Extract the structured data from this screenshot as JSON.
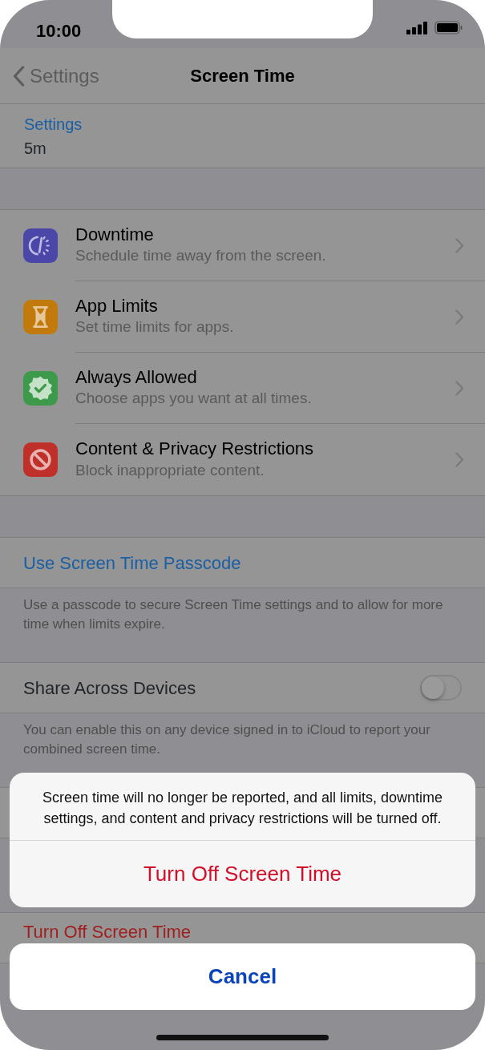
{
  "status_bar": {
    "time": "10:00"
  },
  "nav": {
    "back": "Settings",
    "title": "Screen Time"
  },
  "device_row": {
    "link": "Settings",
    "usage": "5m"
  },
  "menu_items": [
    {
      "kind": "downtime",
      "title": "Downtime",
      "subtitle": "Schedule time away from the screen."
    },
    {
      "kind": "app_limits",
      "title": "App Limits",
      "subtitle": "Set time limits for apps."
    },
    {
      "kind": "always_allowed",
      "title": "Always Allowed",
      "subtitle": "Choose apps you want at all times."
    },
    {
      "kind": "restrictions",
      "title": "Content & Privacy Restrictions",
      "subtitle": "Block inappropriate content."
    }
  ],
  "passcode": {
    "label": "Use Screen Time Passcode",
    "footer": "Use a passcode to secure Screen Time settings and to allow for more time when limits expire."
  },
  "share": {
    "label": "Share Across Devices",
    "on": false,
    "footer": "You can enable this on any device signed in to iCloud to report your combined screen time."
  },
  "turn_off_row": {
    "label": "Turn Off Screen Time"
  },
  "action_sheet": {
    "message": "Screen time will no longer be reported, and all limits, downtime settings, and content and privacy restrictions will be turned off.",
    "action": "Turn Off Screen Time",
    "cancel": "Cancel"
  }
}
